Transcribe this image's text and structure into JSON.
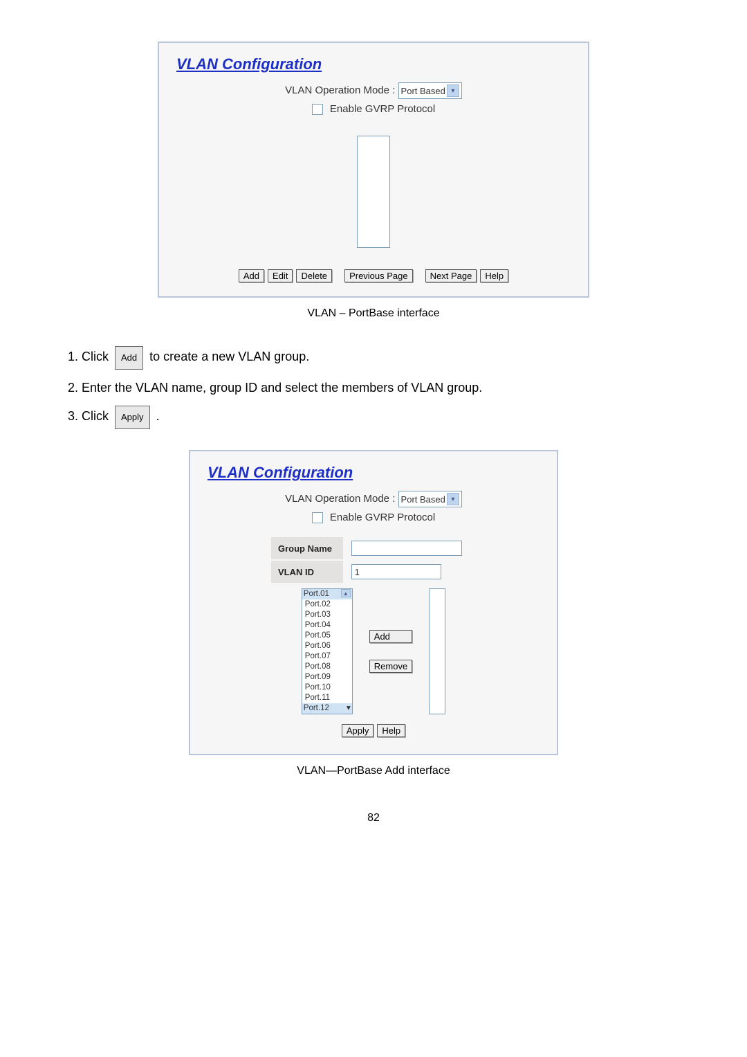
{
  "panel1": {
    "title": "VLAN Configuration",
    "mode_label": "VLAN Operation Mode :",
    "mode_value": "Port Based",
    "gvrp_label": "Enable GVRP Protocol",
    "buttons": {
      "add": "Add",
      "edit": "Edit",
      "delete": "Delete",
      "prev": "Previous Page",
      "next": "Next Page",
      "help": "Help"
    },
    "caption": "VLAN – PortBase interface"
  },
  "instructions": {
    "i1a": "Click",
    "i1_btn": "Add",
    "i1b": "to create a new VLAN group.",
    "i2": "Enter the VLAN name, group ID and select the members of VLAN group.",
    "i3a": "Click",
    "i3_btn": "Apply",
    "i3b": "."
  },
  "panel2": {
    "title": "VLAN Configuration",
    "mode_label": "VLAN Operation Mode :",
    "mode_value": "Port Based",
    "gvrp_label": "Enable GVRP Protocol",
    "group_name_label": "Group Name",
    "group_name_value": "",
    "vlan_id_label": "VLAN ID",
    "vlan_id_value": "1",
    "ports": [
      "Port.01",
      "Port.02",
      "Port.03",
      "Port.04",
      "Port.05",
      "Port.06",
      "Port.07",
      "Port.08",
      "Port.09",
      "Port.10",
      "Port.11",
      "Port.12"
    ],
    "add_btn": "Add",
    "remove_btn": "Remove",
    "apply_btn": "Apply",
    "help_btn": "Help",
    "caption": "VLAN—PortBase Add interface"
  },
  "page_number": "82"
}
